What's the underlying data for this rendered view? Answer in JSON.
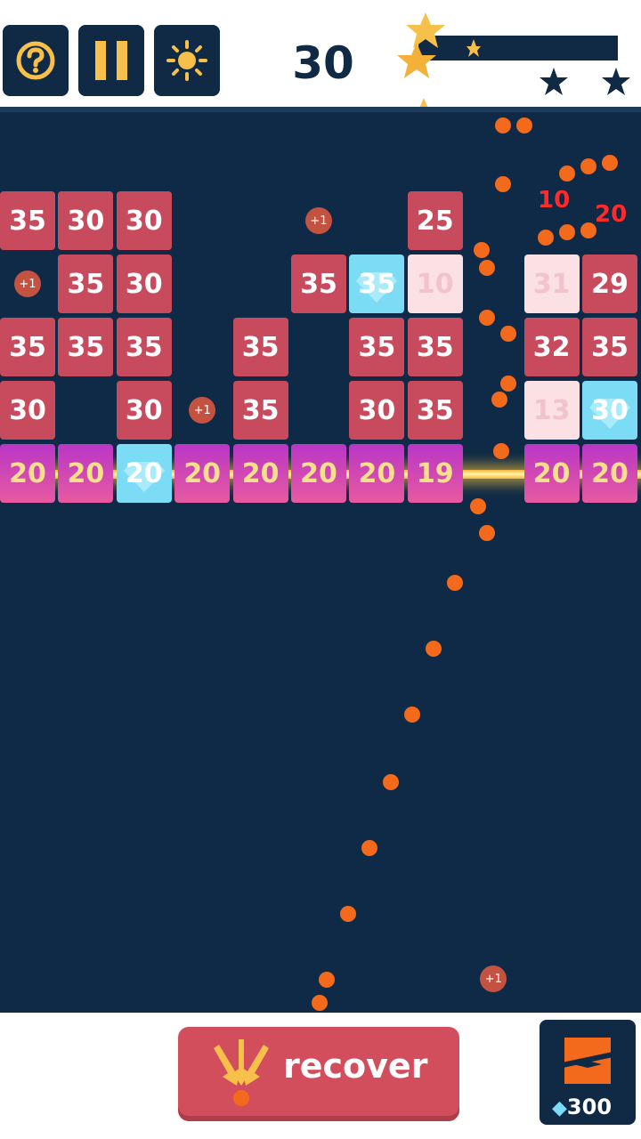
{
  "header": {
    "help_icon": "question-circle-icon",
    "pause_icon": "pause-icon",
    "settings_icon": "sun-icon",
    "score": "30",
    "progress_fraction": 0.0,
    "stars_earned": 0,
    "stars_total": 3
  },
  "colors": {
    "navy": "#102a45",
    "board": "#0f2a46",
    "brick_red": "#c84b5d",
    "brick_pale": "#fbe0e4",
    "brick_diamond": "#7ddcf5",
    "brick_magenta": "#b936c6",
    "ball": "#f36a1d",
    "gold": "#f7c04a"
  },
  "board": {
    "bricks": [
      {
        "col": 0,
        "row": 0,
        "value": "35",
        "kind": "red"
      },
      {
        "col": 1,
        "row": 0,
        "value": "30",
        "kind": "red"
      },
      {
        "col": 2,
        "row": 0,
        "value": "30",
        "kind": "red"
      },
      {
        "col": 7,
        "row": 0,
        "value": "25",
        "kind": "red"
      },
      {
        "col": 1,
        "row": 1,
        "value": "35",
        "kind": "red"
      },
      {
        "col": 2,
        "row": 1,
        "value": "30",
        "kind": "red"
      },
      {
        "col": 5,
        "row": 1,
        "value": "35",
        "kind": "red"
      },
      {
        "col": 6,
        "row": 1,
        "value": "35",
        "kind": "diamond"
      },
      {
        "col": 7,
        "row": 1,
        "value": "10",
        "kind": "pale"
      },
      {
        "col": 9,
        "row": 1,
        "value": "31",
        "kind": "pale"
      },
      {
        "col": 10,
        "row": 1,
        "value": "29",
        "kind": "red"
      },
      {
        "col": 0,
        "row": 2,
        "value": "35",
        "kind": "red"
      },
      {
        "col": 1,
        "row": 2,
        "value": "35",
        "kind": "red"
      },
      {
        "col": 2,
        "row": 2,
        "value": "35",
        "kind": "red"
      },
      {
        "col": 4,
        "row": 2,
        "value": "35",
        "kind": "red"
      },
      {
        "col": 6,
        "row": 2,
        "value": "35",
        "kind": "red"
      },
      {
        "col": 7,
        "row": 2,
        "value": "35",
        "kind": "red"
      },
      {
        "col": 9,
        "row": 2,
        "value": "32",
        "kind": "red"
      },
      {
        "col": 10,
        "row": 2,
        "value": "35",
        "kind": "red"
      },
      {
        "col": 0,
        "row": 3,
        "value": "30",
        "kind": "red"
      },
      {
        "col": 2,
        "row": 3,
        "value": "30",
        "kind": "red"
      },
      {
        "col": 4,
        "row": 3,
        "value": "35",
        "kind": "red"
      },
      {
        "col": 6,
        "row": 3,
        "value": "30",
        "kind": "red"
      },
      {
        "col": 7,
        "row": 3,
        "value": "35",
        "kind": "red"
      },
      {
        "col": 9,
        "row": 3,
        "value": "13",
        "kind": "pale"
      },
      {
        "col": 10,
        "row": 3,
        "value": "30",
        "kind": "diamond"
      },
      {
        "col": 0,
        "row": 4,
        "value": "20",
        "kind": "magenta"
      },
      {
        "col": 1,
        "row": 4,
        "value": "20",
        "kind": "magenta"
      },
      {
        "col": 2,
        "row": 4,
        "value": "20",
        "kind": "diamond"
      },
      {
        "col": 3,
        "row": 4,
        "value": "20",
        "kind": "magenta"
      },
      {
        "col": 4,
        "row": 4,
        "value": "20",
        "kind": "magenta"
      },
      {
        "col": 5,
        "row": 4,
        "value": "20",
        "kind": "magenta"
      },
      {
        "col": 6,
        "row": 4,
        "value": "20",
        "kind": "magenta"
      },
      {
        "col": 7,
        "row": 4,
        "value": "19",
        "kind": "magenta"
      },
      {
        "col": 9,
        "row": 4,
        "value": "20",
        "kind": "magenta"
      },
      {
        "col": 10,
        "row": 4,
        "value": "20",
        "kind": "magenta"
      }
    ],
    "bonus_pickups": [
      {
        "col": 0,
        "row": 1,
        "label": "+1"
      },
      {
        "col": 5,
        "row": 0,
        "label": "+1"
      },
      {
        "col": 3,
        "row": 3,
        "label": "+1"
      },
      {
        "col": 8,
        "row": 12,
        "label": "+1"
      }
    ],
    "damage_popups": [
      "10",
      "20"
    ]
  },
  "bottom": {
    "recover_label": "recover",
    "recover_icon": "arrows-down-icon",
    "shop_icon": "laser-powerup-icon",
    "gem_icon": "diamond-icon",
    "gem_count": "300"
  }
}
